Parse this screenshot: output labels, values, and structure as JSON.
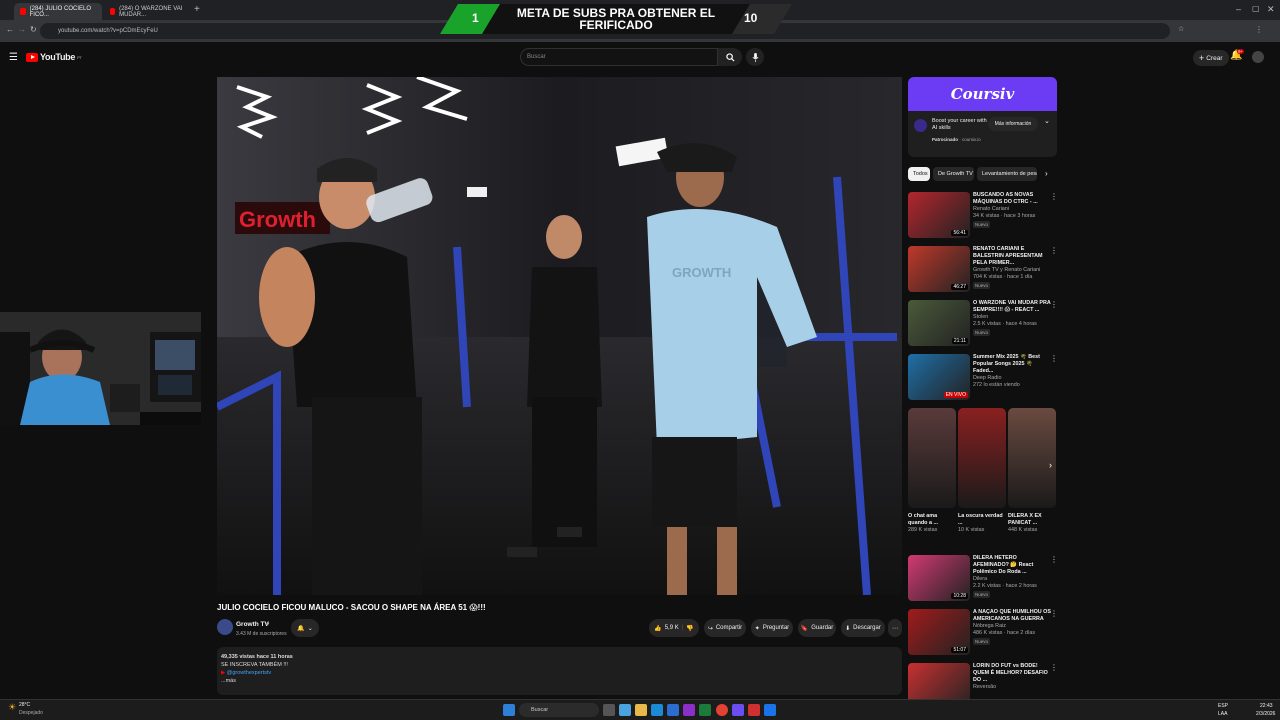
{
  "browser": {
    "tabs": [
      {
        "label": "(284) JULIO COCIELO FICO..."
      },
      {
        "label": "(284) O WARZONE VAI MUDAR..."
      }
    ],
    "url": "youtube.com/watch?v=pCDmEcyFeU"
  },
  "overlay": {
    "left_number": "1",
    "text": "META DE SUBS PRA OBTENER EL FERIFICADO",
    "right_number": "10"
  },
  "youtube": {
    "logo": "YouTube",
    "logo_sup": "PT",
    "search_placeholder": "Buscar",
    "create_label": "Crear",
    "notif_count": "9+"
  },
  "video": {
    "title": "JULIO COCIELO FICOU MALUCO - SACOU O SHAPE NA ÁREA 51 😱!!!",
    "channel": "Growth TV",
    "subscribers": "3.43 M de suscriptores",
    "likes": "5,9 K",
    "share": "Compartir",
    "ask": "Preguntar",
    "save": "Guardar",
    "download": "Descargar",
    "desc_meta": "49,335 vistas  hace 11 horas",
    "desc_line1": "SE INSCREVA TAMBÉM !!!",
    "desc_line2": "@growthexpertstv",
    "desc_more": "...más",
    "gym_sign": "Growth",
    "shirt_text": "GROWTH"
  },
  "ad": {
    "brand": "Coursiv",
    "headline": "Boost your career with AI skills",
    "sponsored": "Patrocinado",
    "domain": "coursiv.io",
    "cta": "Más información"
  },
  "chips": [
    {
      "label": "Todos"
    },
    {
      "label": "De Growth TV"
    },
    {
      "label": "Levantamiento de pesas"
    }
  ],
  "recommendations": [
    {
      "title": "BUSCANDO AS NOVAS MÁQUINAS DO CTRC - ...",
      "channel": "Renato Cariani",
      "stats": "34 K vistas · hace 3 horas",
      "badge": "Nuevo",
      "duration": "56:41",
      "thumb_color": "#b3262e"
    },
    {
      "title": "RENATO CARIANI E BALESTRIN APRESENTAM PELA PRIMER...",
      "channel": "Growth TV y Renato Cariani",
      "stats": "704 K vistas · hace 1 día",
      "badge": "Nuevo",
      "duration": "46:27",
      "thumb_color": "#c0392b"
    },
    {
      "title": "O WARZONE VAI MUDAR PRA SEMPRE!!!! 😱 - REACT ...",
      "channel": "Stolen",
      "stats": "2.5 K vistas · hace 4 horas",
      "badge": "Nuevo",
      "duration": "21:11",
      "thumb_color": "#4a5a3a"
    },
    {
      "title": "Summer Mix 2025 🌴 Best Popular Songs 2025 🌴 Faded...",
      "channel": "Deep Radio",
      "stats": "272 lo están viendo",
      "badge": "EN VIVO",
      "duration": "",
      "thumb_color": "#1f6fa8"
    },
    {
      "title": "DILERA HÉTERO AFEMINADO? 🤔 React Polêmico Do Roda ...",
      "channel": "Dilera",
      "stats": "2.2 K vistas · hace 2 horas",
      "badge": "Nuevo",
      "duration": "10:28",
      "thumb_color": "#d23a72"
    },
    {
      "title": "A NAÇÃO QUE HUMILHOU OS AMERICANOS NA GUERRA",
      ":channel": "",
      "channel": "Nóbrega Raiz",
      "stats": "486 K vistas · hace 2 días",
      "badge": "Nuevo",
      "duration": "51:07",
      "thumb_color": "#a11b1b"
    },
    {
      "title": "LORIN DO FUT vs BODE! QUEM É MELHOR? DESAFIO DO ...",
      "channel": "Reversão",
      "stats": "",
      "badge": "",
      "duration": "",
      "thumb_color": "#c93030"
    }
  ],
  "shorts": [
    {
      "title": "O chat ama quando a ...",
      "views": "289 K vistas",
      "color": "#5a3a3a"
    },
    {
      "title": "La oscura verdad ...",
      "views": "10 K vistas",
      "color": "#8a2020"
    },
    {
      "title": "DILERA X EX PANICAT ...",
      "views": "448 K vistas",
      "color": "#6a4a40"
    }
  ],
  "taskbar": {
    "weather_temp": "28°C",
    "weather_desc": "Despejado",
    "search": "Buscar",
    "lang": "ESP",
    "lang2": "LAA",
    "time": "22:43",
    "date": "2/3/2026"
  }
}
